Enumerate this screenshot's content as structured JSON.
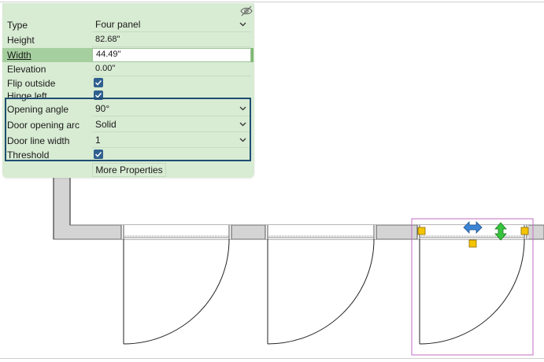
{
  "properties": {
    "rows": [
      {
        "label": "Type",
        "value": "Four panel",
        "kind": "select"
      },
      {
        "label": "Height",
        "value": "82.68\"",
        "kind": "text"
      },
      {
        "label": "Width",
        "value": "44.49\"",
        "kind": "text",
        "selected": true
      },
      {
        "label": "Elevation",
        "value": "0.00\"",
        "kind": "text"
      },
      {
        "label": "Flip outside",
        "value": "",
        "kind": "checkbox",
        "checked": true
      },
      {
        "label": "Hinge left",
        "value": "",
        "kind": "checkbox",
        "checked": true
      },
      {
        "label": "Opening angle",
        "value": "90°",
        "kind": "select"
      },
      {
        "label": "Door opening arc",
        "value": "Solid",
        "kind": "select"
      },
      {
        "label": "Door line width",
        "value": "1",
        "kind": "select"
      },
      {
        "label": "Threshold",
        "value": "",
        "kind": "checkbox",
        "checked": true
      }
    ],
    "more_label": "More Properties"
  },
  "icons": {
    "panel_visibility": "hide-eye-icon",
    "dropdown": "chevron-down-icon",
    "checkbox": "checkmark-icon",
    "flip_horizontal": "double-arrow-horizontal-icon",
    "flip_vertical": "double-arrow-vertical-icon",
    "grip": "square-handle-icon"
  },
  "colors": {
    "panel_bg": "#d8ebd3",
    "selected_label_bg": "#a6cf9f",
    "group_border": "#1f4d73",
    "checkbox": "#2f5f8e",
    "wall_fill": "#d4d4d4",
    "selection_box": "#c36cc3",
    "grip": "#f5c400",
    "flip_h_arrow": "#3b84d6",
    "flip_v_arrow": "#36c43c"
  }
}
